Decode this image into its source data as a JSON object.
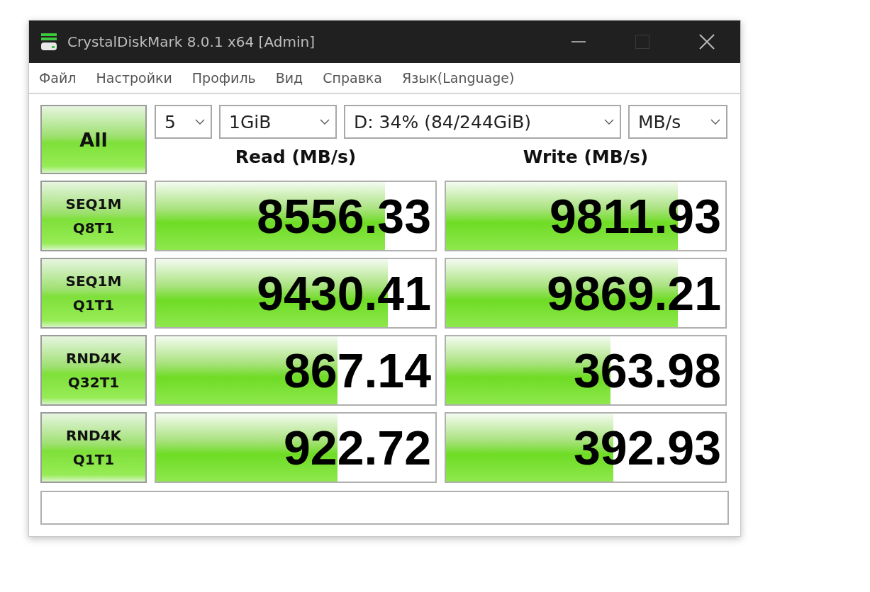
{
  "window": {
    "title": "CrystalDiskMark 8.0.1 x64 [Admin]"
  },
  "menu": [
    "Файл",
    "Настройки",
    "Профиль",
    "Вид",
    "Справка",
    "Язык(Language)"
  ],
  "all_button": "All",
  "selectors": [
    {
      "value": "5"
    },
    {
      "value": "1GiB"
    },
    {
      "value": "D: 34% (84/244GiB)"
    },
    {
      "value": "MB/s"
    }
  ],
  "column_headers": [
    "Read (MB/s)",
    "Write (MB/s)"
  ],
  "tests": [
    {
      "label": [
        "SEQ1M",
        "Q8T1"
      ],
      "read": {
        "value": "8556.33",
        "level": 0.82
      },
      "write": {
        "value": "9811.93",
        "level": 0.83
      }
    },
    {
      "label": [
        "SEQ1M",
        "Q1T1"
      ],
      "read": {
        "value": "9430.41",
        "level": 0.83
      },
      "write": {
        "value": "9869.21",
        "level": 0.83
      }
    },
    {
      "label": [
        "RND4K",
        "Q32T1"
      ],
      "read": {
        "value": "867.14",
        "level": 0.65
      },
      "write": {
        "value": "363.98",
        "level": 0.59
      }
    },
    {
      "label": [
        "RND4K",
        "Q1T1"
      ],
      "read": {
        "value": "922.72",
        "level": 0.65
      },
      "write": {
        "value": "392.93",
        "level": 0.6
      }
    }
  ]
}
